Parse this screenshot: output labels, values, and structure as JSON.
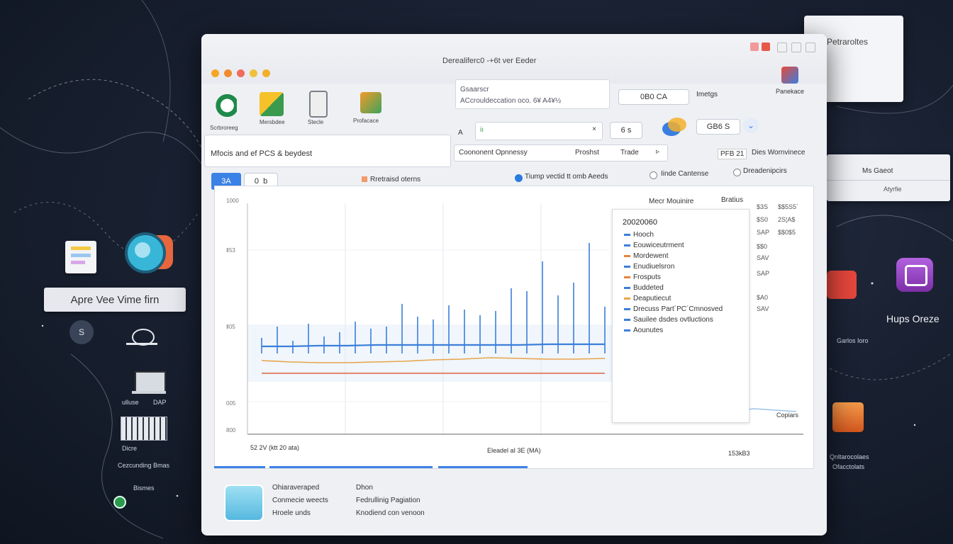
{
  "desktop": {
    "launcher_label": "Apre Vee Vime firn",
    "s_badge": "S",
    "icon_labels": [
      "ulluse",
      "DAP",
      "Dicre",
      "Cezcunding Bmas",
      "Bismes"
    ]
  },
  "right_panels": {
    "top_panel_text": "Petraroltes",
    "mini_title": "Ms Gaeot",
    "mini_sub": "Atyrfie",
    "app_right_label": "Hups Oreze",
    "app_right_sub": "Garlos Ioro",
    "app_bottom_label": "Qnltarocolaes",
    "app_bottom_sub": "Ofacctolats"
  },
  "window": {
    "title": "Derealiferc0 -+6t ver Eeder",
    "toolbar": {
      "items": [
        {
          "label": "Scrbroreeg",
          "color": "#1e8a4a"
        },
        {
          "label": "Mersbdee",
          "color": "#f2b01e"
        },
        {
          "label": "Stecle",
          "color": "#7a7f88"
        },
        {
          "label": "Profacace",
          "color": "#3da35a"
        }
      ],
      "side_label": "Panekace"
    },
    "search": {
      "line1": "Gsaarscr",
      "line2": "ACcrouldeccation oco. 6¥ A4¥½"
    },
    "header_pill": "0B0 CA",
    "header_text": "Imetgs",
    "filter_field": "iı",
    "filter_code": "6 s",
    "gb_pill": "GB6 S",
    "description": "Mfocis and ef PCS & beydest",
    "sort_field": {
      "label": "Coononent Opnnessy",
      "sub": "Proshst",
      "trade": "Trade"
    },
    "year_pill": "PFB 21",
    "dims": "Dies Wornvinece",
    "tabs": {
      "active": "3A",
      "other": "0",
      "arrow": "b"
    },
    "option_retained": "Rretraisd oterns",
    "option_radio1": "Tiump vectid tt omb Aeeds",
    "option_radio2": "Iinde Cantense",
    "option_radio3": "Dreadenipcirs",
    "chart_header": {
      "left": "Mecr Mouinire",
      "right": "Bratius"
    },
    "bottom": {
      "col1": [
        "Ohiaraveraped",
        "Conmecie weects",
        "Hroele unds"
      ],
      "col2": [
        "Dhon",
        "Fedrullinig Pagiation",
        "Knodiend con venoon"
      ]
    }
  },
  "chart_data": {
    "type": "line",
    "title": "",
    "ylabel": "",
    "yticks": [
      "1000",
      "Ⅱ53",
      "Ⅱ05",
      "005",
      "800"
    ],
    "x_start_label": "52 2V (ktt 20 ata)",
    "x_mid_label": "Eleadel aI 3E (MA)",
    "x_end_label": "153kB3",
    "spikes": [
      22,
      38,
      18,
      42,
      24,
      30,
      45,
      35,
      38,
      70,
      52,
      48,
      68,
      62,
      54,
      60,
      92,
      88,
      130,
      82,
      100,
      156,
      66
    ],
    "series": [
      {
        "name": "Hooch",
        "color": "#3b7fd9",
        "values": [
          12,
          12,
          13,
          13,
          14,
          14,
          14,
          14,
          14,
          14,
          15,
          15,
          15
        ]
      },
      {
        "name": "Eouwiceutrment",
        "color": "#e8a44b",
        "values": [
          8,
          6,
          5,
          5,
          6,
          7,
          9,
          10,
          12,
          11,
          10,
          10,
          11
        ]
      },
      {
        "name": "Mordewent",
        "color": "#e06040",
        "values": [
          2,
          2,
          2,
          2,
          2,
          2,
          2,
          2,
          2,
          2,
          2,
          2,
          2
        ]
      }
    ],
    "legend": {
      "title": "20020060",
      "items": [
        {
          "label": "Hooch",
          "color": "#3b7fd9"
        },
        {
          "label": "Eouwiceutrment",
          "color": "#3b7fd9"
        },
        {
          "label": "Mordewent",
          "color": "#e8843a"
        },
        {
          "label": "Enudiuelsron",
          "color": "#3b7fd9"
        },
        {
          "label": "Frosputs",
          "color": "#e8843a"
        },
        {
          "label": "Buddeted",
          "color": "#3b7fd9"
        },
        {
          "label": "Deaputiecut",
          "color": "#e8a44b"
        },
        {
          "label": "Drecuss Part´PC´Cmnosved",
          "color": "#3b7fd9"
        },
        {
          "label": "Sauilee dsdes ovtluctions",
          "color": "#3b7fd9"
        },
        {
          "label": "Aounutes",
          "color": "#3b7fd9"
        }
      ]
    },
    "right_values": [
      {
        "a": "$3S",
        "b": "$$5S5´"
      },
      {
        "a": "$S0",
        "b": "2S¦A$"
      },
      {
        "a": "SAP",
        "b": "$$0$5"
      },
      {
        "a": "$$0",
        "b": ""
      },
      {
        "a": "SAV",
        "b": ""
      },
      {
        "a": "SAP",
        "b": ""
      },
      {
        "a": "$A0",
        "b": ""
      },
      {
        "a": "SAV",
        "b": ""
      }
    ],
    "side_note": "Copiars"
  }
}
